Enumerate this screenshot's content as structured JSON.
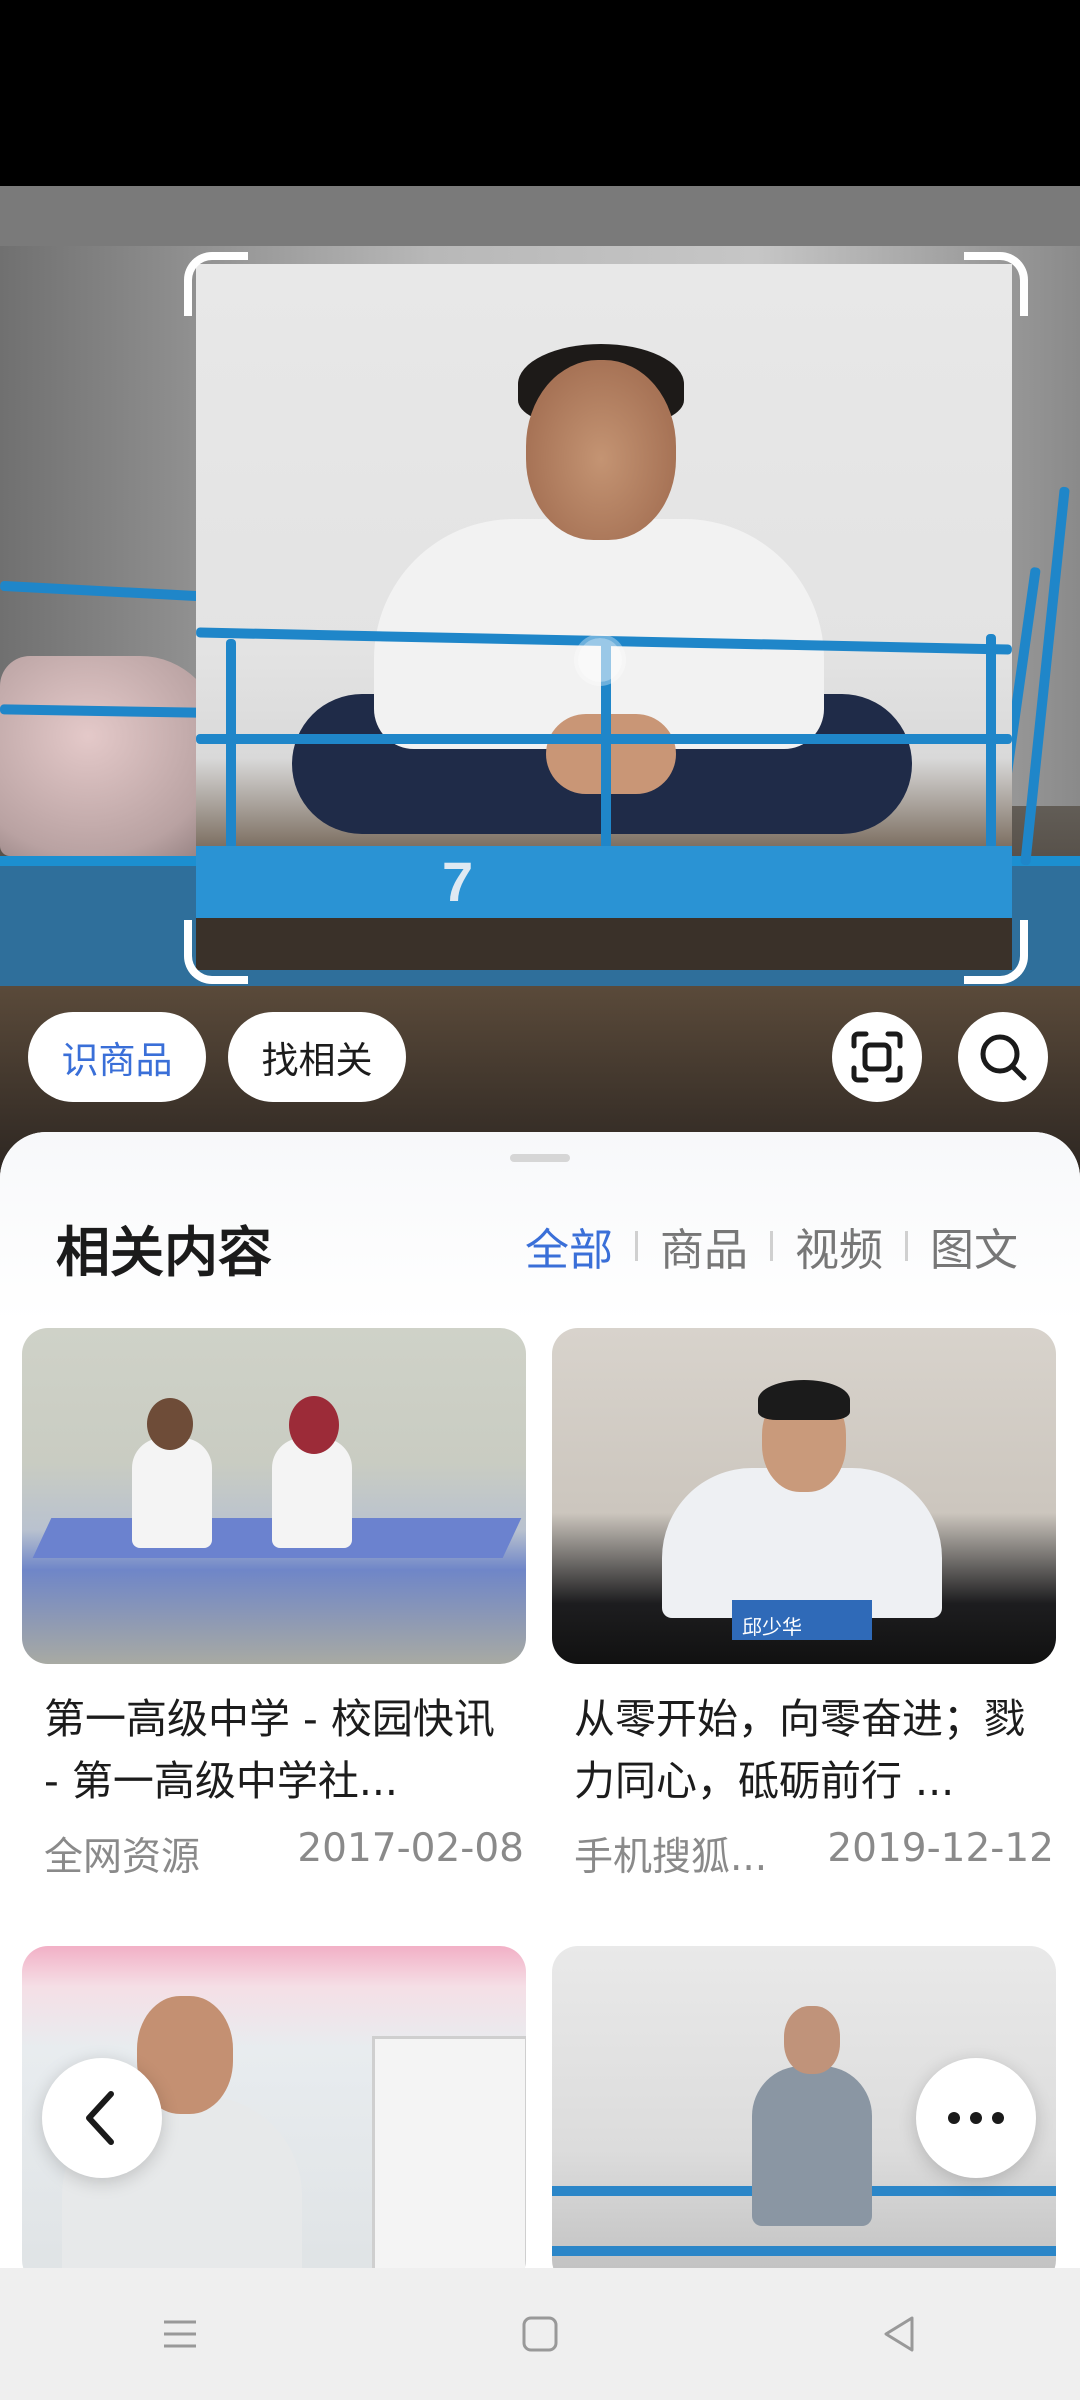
{
  "camera": {
    "bed_number": "7",
    "buttons": {
      "identify_product": "识商品",
      "find_related": "找相关"
    },
    "icons": [
      "scan-frame-icon",
      "search-icon"
    ]
  },
  "results": {
    "title": "相关内容",
    "tabs": [
      {
        "label": "全部",
        "active": true
      },
      {
        "label": "商品",
        "active": false
      },
      {
        "label": "视频",
        "active": false
      },
      {
        "label": "图文",
        "active": false
      }
    ],
    "cards": [
      {
        "title": "第一高级中学 - 校园快讯 - 第一高级中学社...",
        "source": "全网资源",
        "date": "2017-02-08"
      },
      {
        "title": "从零开始，向零奋进；戮力同心，砥砺前行 ...",
        "source": "手机搜狐...",
        "date": "2019-12-12",
        "nameplate": "邱少华"
      },
      {
        "title": "",
        "source": "",
        "date": ""
      },
      {
        "title": "",
        "source": "",
        "date": ""
      }
    ]
  },
  "controls": {
    "back_icon": "chevron-left-icon",
    "more_icon": "more-dots-icon"
  },
  "nav": {
    "icons": [
      "menu-icon",
      "home-icon",
      "back-triangle-icon"
    ]
  },
  "colors": {
    "accent": "#3a6fd8",
    "rail_blue": "#1f86c9"
  }
}
